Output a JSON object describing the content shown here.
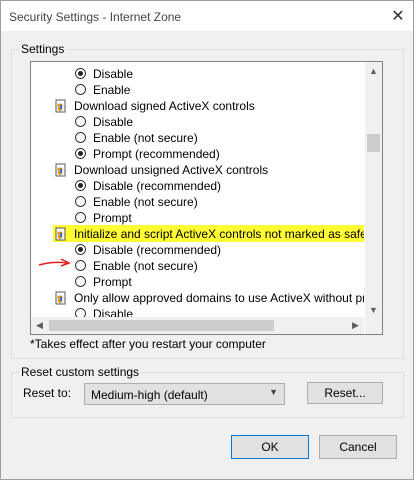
{
  "window": {
    "title": "Security Settings - Internet Zone"
  },
  "settings": {
    "group_label": "Settings",
    "rows": [
      {
        "type": "option",
        "label": "Disable",
        "checked": true
      },
      {
        "type": "option",
        "label": "Enable",
        "checked": false
      },
      {
        "type": "heading",
        "label": "Download signed ActiveX controls"
      },
      {
        "type": "option",
        "label": "Disable",
        "checked": false
      },
      {
        "type": "option",
        "label": "Enable (not secure)",
        "checked": false
      },
      {
        "type": "option",
        "label": "Prompt (recommended)",
        "checked": true
      },
      {
        "type": "heading",
        "label": "Download unsigned ActiveX controls"
      },
      {
        "type": "option",
        "label": "Disable (recommended)",
        "checked": true
      },
      {
        "type": "option",
        "label": "Enable (not secure)",
        "checked": false
      },
      {
        "type": "option",
        "label": "Prompt",
        "checked": false
      },
      {
        "type": "heading",
        "label": "Initialize and script ActiveX controls not marked as safe for sc"
      },
      {
        "type": "option",
        "label": "Disable (recommended)",
        "checked": true
      },
      {
        "type": "option",
        "label": "Enable (not secure)",
        "checked": false
      },
      {
        "type": "option",
        "label": "Prompt",
        "checked": false
      },
      {
        "type": "heading",
        "label": "Only allow approved domains to use ActiveX without prompt"
      },
      {
        "type": "option",
        "label": "Disable",
        "checked": false
      }
    ],
    "note": "*Takes effect after you restart your computer"
  },
  "reset": {
    "group_label": "Reset custom settings",
    "label": "Reset to:",
    "selected": "Medium-high (default)",
    "button": "Reset..."
  },
  "footer": {
    "ok": "OK",
    "cancel": "Cancel"
  },
  "colors": {
    "highlight": "#ffff33",
    "annotation": "#e02020"
  }
}
